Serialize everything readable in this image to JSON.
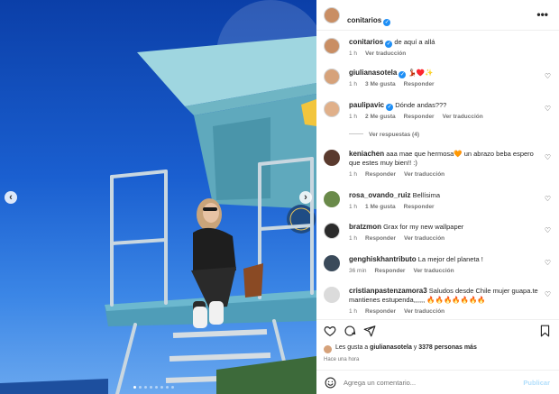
{
  "post": {
    "owner": "conitarios",
    "verified": true,
    "more_label": "•••"
  },
  "caption": {
    "user": "conitarios",
    "text": "de aquí a allá",
    "time": "1 h",
    "translate": "Ver traducción"
  },
  "comments": [
    {
      "user": "giulianasotela",
      "text": "💃🏻♥️✨",
      "time": "1 h",
      "likes": "3 Me gusta",
      "reply": "Responder",
      "translate": ""
    },
    {
      "user": "paulipavic",
      "text": "Dónde andas???",
      "time": "1 h",
      "likes": "2 Me gusta",
      "reply": "Responder",
      "translate": "Ver traducción",
      "view_replies": "Ver respuestas (4)"
    },
    {
      "user": "keniachen",
      "text": "aaa mae que hermosa🧡 un abrazo beba espero que estes muy bien!! :)",
      "time": "1 h",
      "likes": "",
      "reply": "Responder",
      "translate": "Ver traducción"
    },
    {
      "user": "rosa_ovando_ruiz",
      "text": "Bellísima",
      "time": "1 h",
      "likes": "1 Me gusta",
      "reply": "Responder",
      "translate": ""
    },
    {
      "user": "bratzmon",
      "text": "Grax for my new wallpaper",
      "time": "1 h",
      "likes": "",
      "reply": "Responder",
      "translate": "Ver traducción"
    },
    {
      "user": "genghiskhantributo",
      "text": "La mejor del planeta !",
      "time": "36 min",
      "likes": "",
      "reply": "Responder",
      "translate": "Ver traducción"
    },
    {
      "user": "cristianpastenzamora3",
      "text": "Saludos desde Chile mujer guapa.te mantienes estupenda,,,,,, 🔥🔥🔥🔥🔥🔥🔥",
      "time": "1 h",
      "likes": "",
      "reply": "Responder",
      "translate": "Ver traducción"
    }
  ],
  "footer": {
    "likes_prefix": "Les gusta a",
    "likes_user": "giulianasotela",
    "likes_mid": "y",
    "likes_count": "3378 personas más",
    "time": "Hace una hora",
    "add_placeholder": "Agrega un comentario...",
    "post_label": "Publicar"
  },
  "icons": {
    "heart": "heart-icon",
    "comment": "comment-icon",
    "share": "share-icon",
    "save": "bookmark-icon",
    "emoji": "emoji-icon",
    "verified": "verified-badge-icon"
  },
  "colors": {
    "accent": "#0095f6",
    "verified": "#1f8ff5",
    "muted": "#737373"
  }
}
